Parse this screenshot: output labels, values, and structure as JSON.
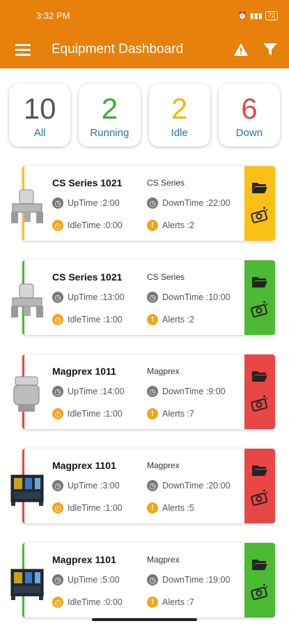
{
  "status": {
    "time": "3:32 PM",
    "battery": "72"
  },
  "app_bar": {
    "title": "Equipment Dashboard",
    "icons": [
      "menu-icon",
      "alert-icon",
      "filter-icon"
    ]
  },
  "summary": [
    {
      "count": "10",
      "label": "All",
      "color": "#555555"
    },
    {
      "count": "2",
      "label": "Running",
      "color": "#3aaa35"
    },
    {
      "count": "2",
      "label": "Idle",
      "color": "#f2b705"
    },
    {
      "count": "6",
      "label": "Down",
      "color": "#e04848"
    }
  ],
  "labels": {
    "uptime": "UpTime : ",
    "downtime": "DownTime : ",
    "idletime": "IdleTime : ",
    "alerts": "Alerts : "
  },
  "status_colors": {
    "running": "#4cba33",
    "idle": "#fcbf16",
    "down": "#e94646"
  },
  "equipment": [
    {
      "name": "CS Series 1021",
      "series": "CS Series",
      "uptime": "2:00",
      "downtime": "22:00",
      "idletime": "0:00",
      "alerts": "2",
      "status": "idle",
      "machine": "machine-cs-icon"
    },
    {
      "name": "CS Series 1021",
      "series": "CS Series",
      "uptime": "13:00",
      "downtime": "10:00",
      "idletime": "1:00",
      "alerts": "2",
      "status": "running",
      "machine": "machine-cs-icon"
    },
    {
      "name": "Magprex 1011",
      "series": "Magprex",
      "uptime": "14:00",
      "downtime": "9:00",
      "idletime": "1:00",
      "alerts": "7",
      "status": "down",
      "machine": "machine-magprex-icon"
    },
    {
      "name": "Magprex 1101",
      "series": "Magprex",
      "uptime": "3:00",
      "downtime": "20:00",
      "idletime": "1:00",
      "alerts": "5",
      "status": "down",
      "machine": "machine-panel-icon"
    },
    {
      "name": "Magprex 1101",
      "series": "Magprex",
      "uptime": "5:00",
      "downtime": "19:00",
      "idletime": "0:00",
      "alerts": "7",
      "status": "running",
      "machine": "machine-panel-icon"
    }
  ]
}
